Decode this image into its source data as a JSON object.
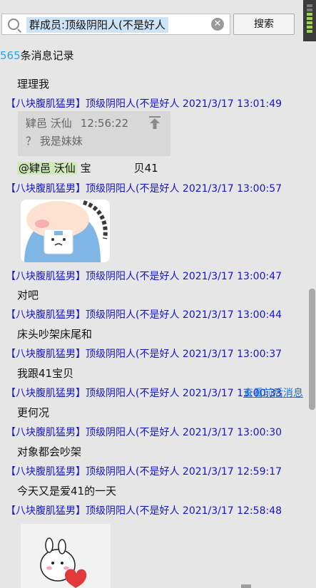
{
  "search": {
    "value": "群成员:顶级阴阳人(不是好人",
    "button_label": "搜索"
  },
  "result_count": {
    "number": "565",
    "suffix": "条消息记录"
  },
  "messages": [
    {
      "header": "【八块腹肌猛男】顶级阴阳人(不是好人 2021/3/17 13:01:49"
    },
    {
      "header": "【八块腹肌猛男】顶级阴阳人(不是好人 2021/3/17 13:00:57"
    },
    {
      "header": "【八块腹肌猛男】顶级阴阳人(不是好人 2021/3/17 13:00:47"
    },
    {
      "header": "【八块腹肌猛男】顶级阴阳人(不是好人 2021/3/17 13:00:44"
    },
    {
      "header": "【八块腹肌猛男】顶级阴阳人(不是好人 2021/3/17 13:00:37"
    },
    {
      "header": "【八块腹肌猛男】顶级阴阳人(不是好人 2021/3/17 13:00:33"
    },
    {
      "header": "【八块腹肌猛男】顶级阴阳人(不是好人 2021/3/17 13:00:30"
    },
    {
      "header": "【八块腹肌猛男】顶级阴阳人(不是好人 2021/3/17 12:59:17"
    },
    {
      "header": "【八块腹肌猛男】顶级阴阳人(不是好人 2021/3/17 12:58:48"
    }
  ],
  "bodies": {
    "top": "理理我",
    "duiba": "对吧",
    "chuangtou": "床头吵架床尾和",
    "wogen": "我跟41宝贝",
    "genghe": "更何况",
    "duixiang": "对象都会吵架",
    "jintian": "今天又是爱41的一天"
  },
  "quote": {
    "author": "肄邑 沃仙",
    "time": "12:56:22",
    "text": "？ 我是妹妹"
  },
  "mention_line": {
    "mention": "@肄邑 沃仙",
    "part1": "宝",
    "part2": "贝41"
  },
  "view_context_link": "查看前后消息",
  "icons": {
    "search": "search-icon",
    "clear": "clear-icon",
    "pin": "pin-to-top-icon"
  }
}
